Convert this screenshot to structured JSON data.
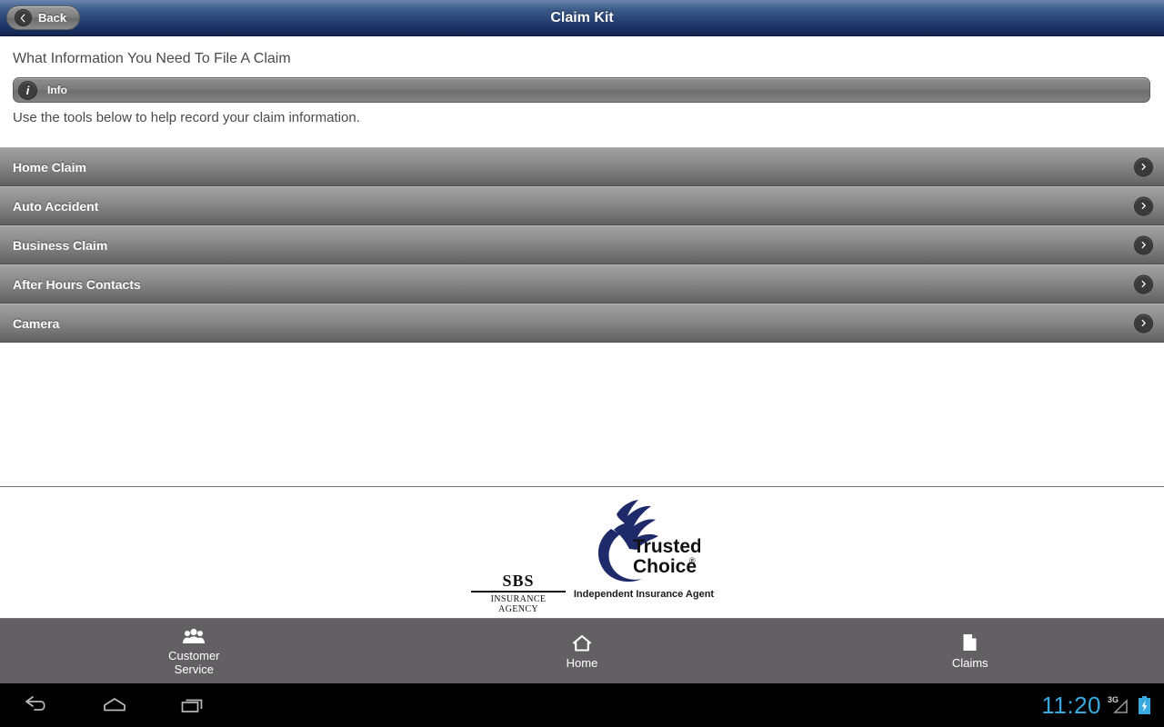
{
  "titlebar": {
    "title": "Claim Kit",
    "back_label": "Back",
    "back_icon": "chevron-left-icon"
  },
  "content": {
    "heading": "What Information You Need To File A Claim",
    "info_label": "Info",
    "info_icon": "info-icon",
    "subtext": "Use the tools below to help record your claim information."
  },
  "list": {
    "items": [
      {
        "label": "Home Claim",
        "chevron": "chevron-right-icon"
      },
      {
        "label": "Auto Accident",
        "chevron": "chevron-right-icon"
      },
      {
        "label": "Business Claim",
        "chevron": "chevron-right-icon"
      },
      {
        "label": "After Hours Contacts",
        "chevron": "chevron-right-icon"
      },
      {
        "label": "Camera",
        "chevron": "chevron-right-icon"
      }
    ]
  },
  "footer": {
    "trusted_choice": {
      "line1": "Trusted",
      "line2": "Choice",
      "registered_mark": "®",
      "caption": "Independent Insurance Agent",
      "logo_icon": "eagle-swoosh-icon",
      "color": "#1f2a6b"
    },
    "sbs": {
      "name": "SBS",
      "subtitle": "INSURANCE AGENCY"
    }
  },
  "tabbar": {
    "background": "#636064",
    "tabs": [
      {
        "label": "Customer\nService",
        "label_line1": "Customer",
        "label_line2": "Service",
        "icon": "people-group-icon"
      },
      {
        "label": "Home",
        "label_line1": "Home",
        "label_line2": "",
        "icon": "house-icon"
      },
      {
        "label": "Claims",
        "label_line1": "Claims",
        "label_line2": "",
        "icon": "document-icon"
      }
    ]
  },
  "navbar": {
    "back_icon": "android-back-icon",
    "home_icon": "android-home-icon",
    "recents_icon": "android-recents-icon",
    "clock": "11:20",
    "clock_color": "#3aa9e0",
    "network_label": "3G",
    "signal_icon": "signal-bars-icon",
    "battery_icon": "battery-charging-icon"
  }
}
